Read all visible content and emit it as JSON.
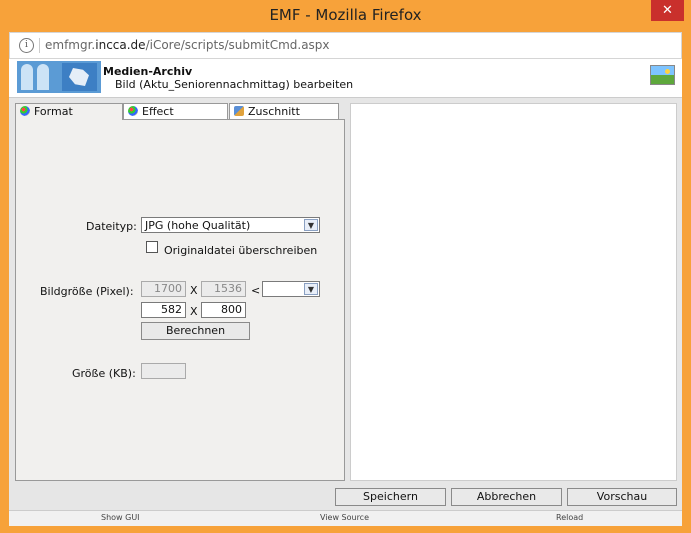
{
  "window": {
    "title": "EMF - Mozilla Firefox",
    "close_glyph": "✕"
  },
  "urlbar": {
    "host_prefix": "emfmgr.",
    "host_domain": "incca.de",
    "path": "/iCore/scripts/submitCmd.aspx",
    "info_glyph": "i"
  },
  "header": {
    "title": "Medien-Archiv",
    "subtitle": "Bild (Aktu_Seniorennachmittag) bearbeiten"
  },
  "tabs": [
    {
      "label": "Format",
      "icon": "palette-icon",
      "active": true
    },
    {
      "label": "Effect",
      "icon": "palette-icon",
      "active": false
    },
    {
      "label": "Zuschnitt",
      "icon": "crop-icon",
      "active": false
    }
  ],
  "format": {
    "filetype_label": "Dateityp:",
    "filetype_value": "JPG (hohe Qualität)",
    "overwrite_label": "Originaldatei überschreiben",
    "imagesize_label": "Bildgröße (Pixel):",
    "orig_width": "1700",
    "orig_height": "1536",
    "x_sep": "X",
    "lt_sep": "<",
    "preset_value": "",
    "new_width": "582",
    "new_height": "800",
    "calculate_label": "Berechnen",
    "size_kb_label": "Größe (KB):",
    "size_kb_value": ""
  },
  "actions": {
    "save": "Speichern",
    "cancel": "Abbrechen",
    "preview": "Vorschau"
  },
  "footer": {
    "show_gui": "Show GUI",
    "view_source": "View Source",
    "reload": "Reload"
  },
  "colors": {
    "window_frame": "#f7a23a",
    "close_button": "#c9302c",
    "panel_bg": "#f1f0ee"
  }
}
